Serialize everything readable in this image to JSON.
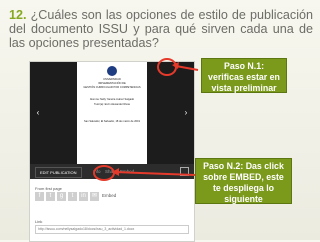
{
  "slide": {
    "number": "12.",
    "question": "¿Cuáles son las opciones de estilo de publicación del documento ISSU y para qué sirven cada una de las opciones presentadas?"
  },
  "embed": {
    "doc_lines": [
      "UNIVERSIDAD",
      "IMPLEMENTACIÓN DE",
      "GESTIÓN CURRICULAR POR COMPETENCIAS",
      "Alumna: Nelly Yaneira Juárez Salgado",
      "Tutor(a): Ervin Alexander Rivas",
      "San Salvador, El Salvador, 18 de marzo de 2019"
    ],
    "edit_button": "EDIT PUBLICATION",
    "info_label": "Info",
    "share_label": "Share",
    "embed_label": "Embed",
    "from_label": "From first page",
    "embed_tag": "Embed",
    "link_label": "Link",
    "url": "http://issuu.com/nellysalgado18/docs/issu_3_actividad_1.docx",
    "social_icons": [
      "facebook-icon",
      "twitter-icon",
      "google-plus-icon",
      "tumblr-icon",
      "linkedin-icon",
      "email-icon"
    ]
  },
  "callouts": {
    "paso1": "Paso N.1: verificas estar en vista preliminar",
    "paso2": "Paso N.2: Das click sobre EMBED, este te despliega lo siguiente"
  },
  "colors": {
    "accent": "#7b9a1c",
    "highlight": "#e53a2b"
  }
}
